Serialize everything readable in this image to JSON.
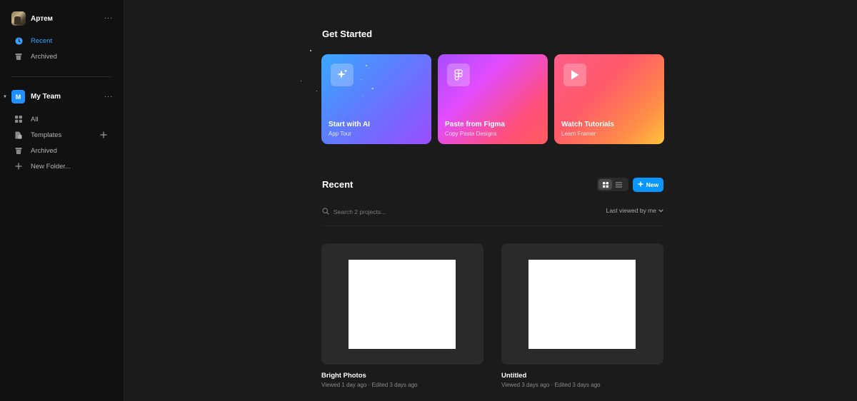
{
  "user": {
    "name": "Артем",
    "menu_label": "···"
  },
  "sidebar": {
    "top_items": [
      {
        "label": "Recent",
        "icon": "clock-icon",
        "active": true
      },
      {
        "label": "Archived",
        "icon": "trash-icon",
        "active": false
      }
    ],
    "team": {
      "badge": "M",
      "name": "My Team",
      "menu_label": "···"
    },
    "team_items": [
      {
        "label": "All",
        "icon": "grid-icon"
      },
      {
        "label": "Templates",
        "icon": "templates-icon"
      },
      {
        "label": "Archived",
        "icon": "trash-icon"
      },
      {
        "label": "New Folder...",
        "icon": "plus-icon"
      }
    ]
  },
  "get_started": {
    "title": "Get Started",
    "cards": [
      {
        "title": "Start with AI",
        "subtitle": "App Tour",
        "icon": "sparkle-icon"
      },
      {
        "title": "Paste from Figma",
        "subtitle": "Copy Paste Designs",
        "icon": "figma-icon"
      },
      {
        "title": "Watch Tutorials",
        "subtitle": "Learn Framer",
        "icon": "play-icon"
      }
    ]
  },
  "recent": {
    "title": "Recent",
    "new_label": "New",
    "search_placeholder": "Search 2 projects...",
    "sort_label": "Last viewed by me",
    "projects": [
      {
        "name": "Bright Photos",
        "meta": "Viewed 1 day ago · Edited 3 days ago"
      },
      {
        "name": "Untitled",
        "meta": "Viewed 3 days ago · Edited 3 days ago"
      }
    ]
  },
  "colors": {
    "accent": "#0a96ff",
    "active_nav": "#3aa0ff",
    "background": "#1b1b1b",
    "sidebar": "#111111"
  }
}
